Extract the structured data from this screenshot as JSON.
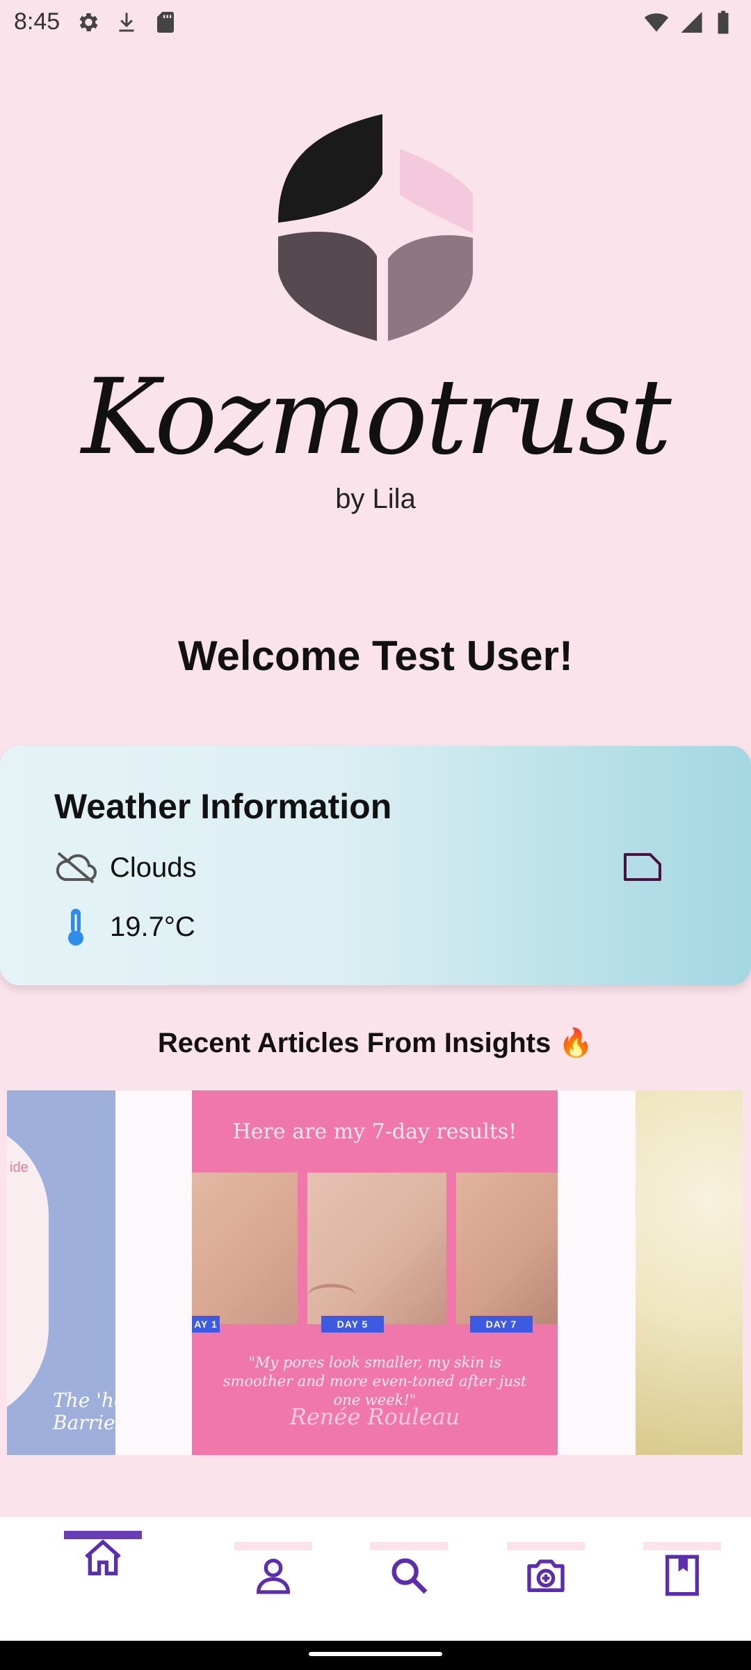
{
  "status_bar": {
    "time": "8:45",
    "left_icons": [
      "settings-gear-icon",
      "download-icon",
      "sd-card-icon"
    ],
    "right_icons": [
      "wifi-icon",
      "cell-signal-icon",
      "battery-icon"
    ]
  },
  "branding": {
    "app_name": "Kozmotrust",
    "byline": "by Lila",
    "logo_colors": [
      "#1A1A1A",
      "#F4C9DD",
      "#564A50",
      "#8E7682"
    ]
  },
  "welcome_text": "Welcome Test User!",
  "weather": {
    "title": "Weather Information",
    "condition_icon": "cloud-off-icon",
    "condition": "Clouds",
    "temperature_icon": "thermometer-icon",
    "temperature": "19.7°C",
    "action_icon": "label-outline-icon"
  },
  "articles": {
    "section_title": "Recent Articles From Insights 🔥",
    "slides": [
      {
        "left_partial_text_top": "ide",
        "left_partial_text_bottom": "The 'hov\nBarrier"
      },
      {
        "heading": "Here are my 7-day results!",
        "day_labels": [
          "AY 1",
          "DAY 5",
          "DAY 7"
        ],
        "quote": "\"My pores look smaller, my skin is smoother and more even-toned after just one week!\"",
        "signature": "Renée Rouleau"
      },
      {}
    ]
  },
  "bottom_nav": {
    "items": [
      {
        "icon": "home-icon",
        "active": true
      },
      {
        "icon": "person-icon",
        "active": false
      },
      {
        "icon": "search-icon",
        "active": false
      },
      {
        "icon": "camera-icon",
        "active": false
      },
      {
        "icon": "bookmark-icon",
        "active": false
      }
    ],
    "active_color": "#6A3DB8",
    "indicator_inactive_color": "#FBE3EB",
    "icon_color": "#5B2DB0"
  }
}
